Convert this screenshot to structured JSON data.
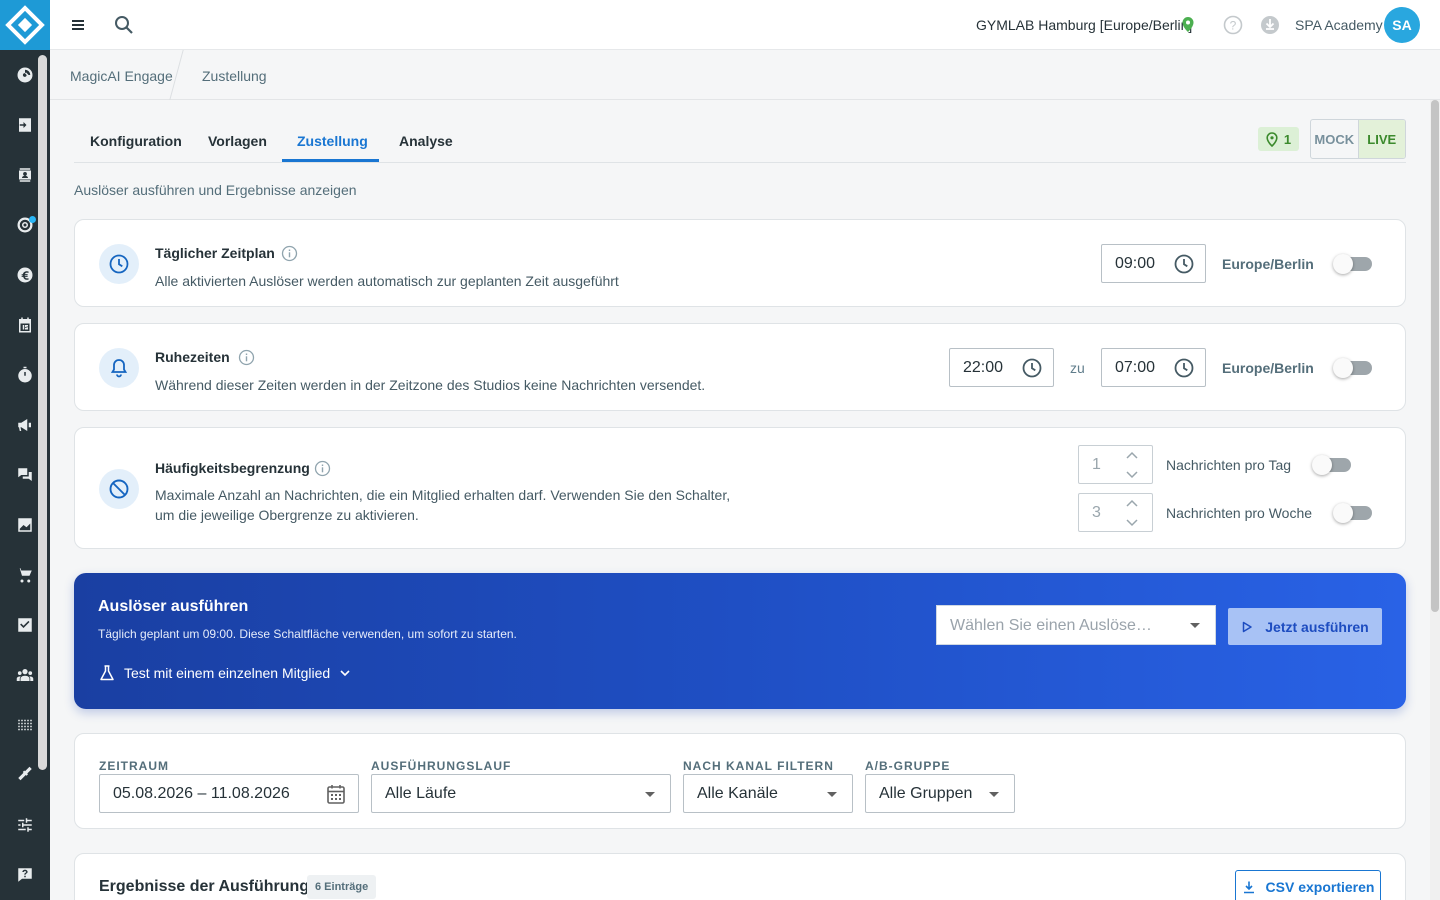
{
  "topbar": {
    "studio": "GYMLAB Hamburg [Europe/Berlin]",
    "user_name": "SPA Academy",
    "avatar_initials": "SA"
  },
  "breadcrumb": [
    "MagicAI Engage",
    "Zustellung"
  ],
  "tabs": [
    {
      "label": "Konfiguration"
    },
    {
      "label": "Vorlagen"
    },
    {
      "label": "Zustellung",
      "active": true
    },
    {
      "label": "Analyse"
    }
  ],
  "location_count": "1",
  "mode": {
    "mock": "MOCK",
    "live": "LIVE",
    "selected": "LIVE"
  },
  "subtitle": "Auslöser ausführen und Ergebnisse anzeigen",
  "schedule": {
    "title": "Täglicher Zeitplan",
    "description": "Alle aktivierten Auslöser werden automatisch zur geplanten Zeit ausgeführt",
    "time": "09:00",
    "timezone": "Europe/Berlin",
    "enabled": false
  },
  "quiet_hours": {
    "title": "Ruhezeiten",
    "description": "Während dieser Zeiten werden in der Zeitzone des Studios keine Nachrichten versendet.",
    "from": "22:00",
    "separator": "zu",
    "to": "07:00",
    "timezone": "Europe/Berlin",
    "enabled": false
  },
  "frequency": {
    "title": "Häufigkeitsbegrenzung",
    "description_line1": "Maximale Anzahl an Nachrichten, die ein Mitglied erhalten darf. Verwenden Sie den Schalter,",
    "description_line2": "um die jeweilige Obergrenze zu aktivieren.",
    "per_day_value": "1",
    "per_day_label": "Nachrichten pro Tag",
    "per_day_enabled": false,
    "per_week_value": "3",
    "per_week_label": "Nachrichten pro Woche",
    "per_week_enabled": false
  },
  "run_trigger": {
    "title": "Auslöser ausführen",
    "description": "Täglich geplant um 09:00. Diese Schaltfläche verwenden, um sofort zu starten.",
    "test_label": "Test mit einem einzelnen Mitglied",
    "select_placeholder": "Wählen Sie einen Auslöse…",
    "run_button": "Jetzt ausführen"
  },
  "filters": {
    "period_label": "ZEITRAUM",
    "period_value": "05.08.2026 – 11.08.2026",
    "run_label": "AUSFÜHRUNGSLAUF",
    "run_value": "Alle Läufe",
    "channel_label": "NACH KANAL FILTERN",
    "channel_value": "Alle Kanäle",
    "group_label": "A/B-GRUPPE",
    "group_value": "Alle Gruppen"
  },
  "results": {
    "title": "Ergebnisse der Ausführung",
    "count": "6 Einträge",
    "export_button": "CSV exportieren"
  },
  "colors": {
    "primary": "#1976d2",
    "sidebar": "#263238",
    "logo": "#1e9ad6",
    "banner": "#1f4fc4",
    "live_green": "#3b8a2c"
  }
}
